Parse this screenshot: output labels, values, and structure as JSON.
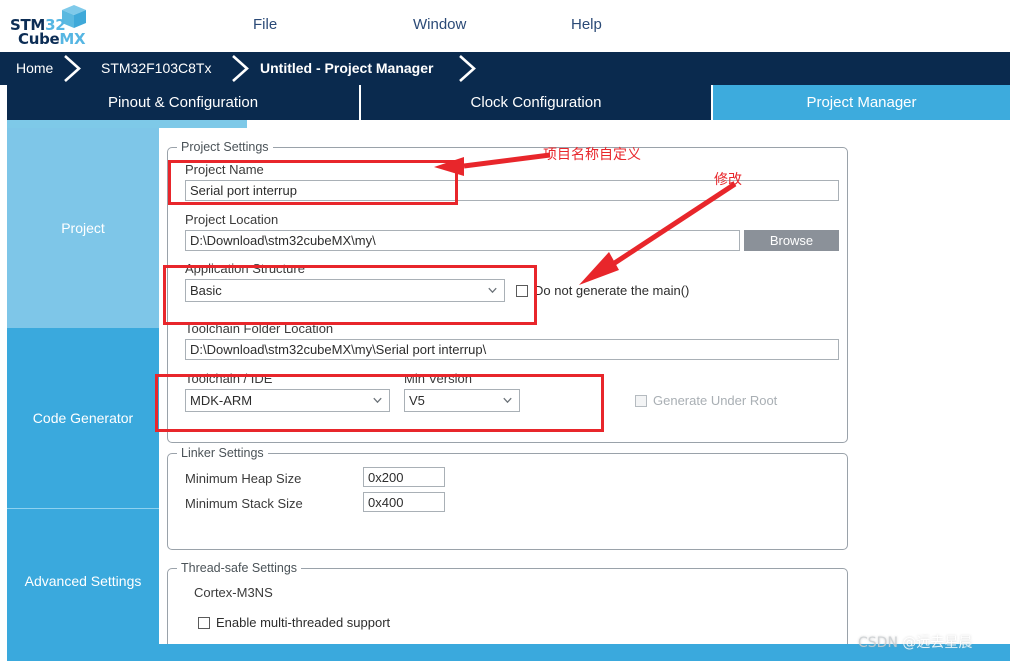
{
  "app": {
    "logo_line1_prefix": "STM",
    "logo_line1_suffix": "32",
    "logo_line2_prefix": "Cube",
    "logo_line2_suffix": "MX",
    "accent_dark": "#0a2a4e",
    "accent_blue": "#3aa9dd",
    "accent_light": "#7ec6e8",
    "annotation_red": "#e8262b"
  },
  "menu": {
    "items": [
      {
        "label": "File"
      },
      {
        "label": "Window"
      },
      {
        "label": "Help"
      }
    ]
  },
  "breadcrumb": {
    "items": [
      {
        "label": "Home"
      },
      {
        "label": "STM32F103C8Tx"
      },
      {
        "label": "Untitled - Project Manager"
      }
    ]
  },
  "tabs": [
    {
      "label": "Pinout & Configuration",
      "active": false
    },
    {
      "label": "Clock Configuration",
      "active": false
    },
    {
      "label": "Project Manager",
      "active": true
    }
  ],
  "sidebar": {
    "items": [
      {
        "label": "Project",
        "selected": true
      },
      {
        "label": "Code Generator",
        "selected": false
      },
      {
        "label": "Advanced Settings",
        "selected": false
      }
    ]
  },
  "project_settings": {
    "group_title": "Project Settings",
    "project_name": {
      "label": "Project Name",
      "value": "Serial port interrup"
    },
    "project_location": {
      "label": "Project Location",
      "value": "D:\\Download\\stm32cubeMX\\my\\",
      "browse_label": "Browse"
    },
    "application_structure": {
      "label": "Application Structure",
      "value": "Basic",
      "no_main_checkbox": {
        "label": "Do not generate the main()",
        "checked": false
      }
    },
    "toolchain_folder_location": {
      "label": "Toolchain Folder Location",
      "value": "D:\\Download\\stm32cubeMX\\my\\Serial port interrup\\"
    },
    "toolchain_ide": {
      "label": "Toolchain / IDE",
      "value": "MDK-ARM"
    },
    "min_version": {
      "label": "Min Version",
      "value": "V5"
    },
    "generate_under_root": {
      "label": "Generate Under Root",
      "checked": false,
      "disabled": true
    }
  },
  "linker_settings": {
    "group_title": "Linker Settings",
    "heap": {
      "label": "Minimum Heap Size",
      "value": "0x200"
    },
    "stack": {
      "label": "Minimum Stack Size",
      "value": "0x400"
    }
  },
  "thread_safe_settings": {
    "group_title": "Thread-safe Settings",
    "core_label": "Cortex-M3NS",
    "enable_multithread": {
      "label": "Enable multi-threaded support",
      "checked": false
    }
  },
  "annotations": [
    {
      "text": "项目名称自定义"
    },
    {
      "text": "修改"
    }
  ],
  "watermark": {
    "prefix": "CSDN ",
    "handle": "@远去星晨"
  }
}
